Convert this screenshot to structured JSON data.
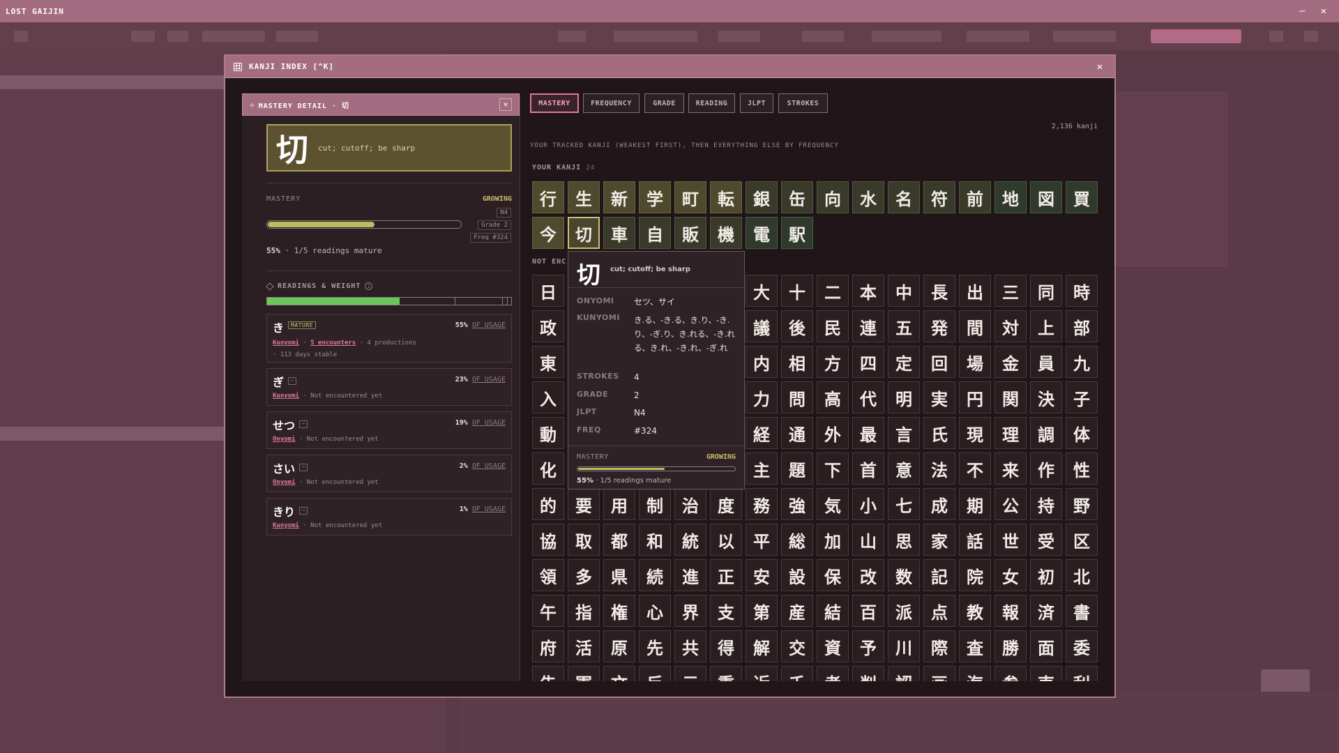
{
  "os": {
    "title": "LOST GAIJIN",
    "minimize": "—",
    "close": "✕"
  },
  "modal": {
    "title": "KANJI INDEX [^K]",
    "close": "✕"
  },
  "detail": {
    "title": "MASTERY DETAIL · 切",
    "close": "✕",
    "kanji": "切",
    "gloss": "cut; cutoff; be sharp",
    "mastery_label": "MASTERY",
    "mastery_value": "GROWING",
    "badges": [
      "N4",
      "Grade 2",
      "Freq #324"
    ],
    "progress": 0.55,
    "pct_text": "55%",
    "pct_rest": " · 1/5 readings mature",
    "readings_label": "READINGS & WEIGHT",
    "readings": [
      {
        "kana": "き",
        "tag": "MATURE",
        "pct": "55%",
        "of": "OF USAGE",
        "type": "Kunyomi",
        "encounters": "5 encounters",
        "productions": " · 4 productions",
        "stable": "· 113 days stable"
      },
      {
        "kana": "ぎ",
        "tag": "–",
        "pct": "23%",
        "of": "OF USAGE",
        "type": "Kunyomi",
        "note": " · Not encountered yet"
      },
      {
        "kana": "せつ",
        "tag": "–",
        "pct": "19%",
        "of": "OF USAGE",
        "type": "Onyomi",
        "note": " · Not encountered yet"
      },
      {
        "kana": "さい",
        "tag": "–",
        "pct": "2%",
        "of": "OF USAGE",
        "type": "Onyomi",
        "note": " · Not encountered yet"
      },
      {
        "kana": "きり",
        "tag": "–",
        "pct": "1%",
        "of": "OF USAGE",
        "type": "Kunyomi",
        "note": " · Not encountered yet"
      }
    ]
  },
  "tabs": [
    "MASTERY",
    "FREQUENCY",
    "GRADE",
    "READING",
    "JLPT",
    "STROKES"
  ],
  "count": "2,136 kanji",
  "hint": "YOUR TRACKED KANJI (WEAKEST FIRST), THEN EVERYTHING ELSE BY FREQUENCY",
  "your_label": "YOUR KANJI",
  "your_count": "24",
  "nenc_label": "NOT ENC",
  "your_kanji": [
    "行",
    "生",
    "新",
    "学",
    "町",
    "転",
    "銀",
    "缶",
    "向",
    "水",
    "名",
    "符",
    "前",
    "地",
    "図",
    "買",
    "今",
    "切",
    "車",
    "自",
    "販",
    "機",
    "電",
    "駅"
  ],
  "grid_rows": [
    [
      "日",
      "",
      "",
      "",
      "",
      "",
      "大",
      "十",
      "二",
      "本",
      "中",
      "長",
      "出",
      "三",
      "同",
      "時"
    ],
    [
      "政",
      "",
      "",
      "",
      "",
      "",
      "議",
      "後",
      "民",
      "連",
      "五",
      "発",
      "間",
      "対",
      "上",
      "部"
    ],
    [
      "東",
      "",
      "",
      "",
      "",
      "",
      "内",
      "相",
      "方",
      "四",
      "定",
      "回",
      "場",
      "金",
      "員",
      "九"
    ],
    [
      "入",
      "",
      "",
      "",
      "",
      "",
      "力",
      "問",
      "高",
      "代",
      "明",
      "実",
      "円",
      "関",
      "決",
      "子"
    ],
    [
      "動",
      "",
      "",
      "",
      "",
      "",
      "経",
      "通",
      "外",
      "最",
      "言",
      "氏",
      "現",
      "理",
      "調",
      "体"
    ],
    [
      "化",
      "",
      "",
      "",
      "",
      "",
      "主",
      "題",
      "下",
      "首",
      "意",
      "法",
      "不",
      "来",
      "作",
      "性"
    ],
    [
      "的",
      "要",
      "用",
      "制",
      "治",
      "度",
      "務",
      "強",
      "気",
      "小",
      "七",
      "成",
      "期",
      "公",
      "持",
      "野"
    ],
    [
      "協",
      "取",
      "都",
      "和",
      "統",
      "以",
      "平",
      "総",
      "加",
      "山",
      "思",
      "家",
      "話",
      "世",
      "受",
      "区"
    ],
    [
      "領",
      "多",
      "県",
      "続",
      "進",
      "正",
      "安",
      "設",
      "保",
      "改",
      "数",
      "記",
      "院",
      "女",
      "初",
      "北"
    ],
    [
      "午",
      "指",
      "権",
      "心",
      "界",
      "支",
      "第",
      "産",
      "結",
      "百",
      "派",
      "点",
      "教",
      "報",
      "済",
      "書"
    ],
    [
      "府",
      "活",
      "原",
      "先",
      "共",
      "得",
      "解",
      "交",
      "資",
      "予",
      "川",
      "際",
      "査",
      "勝",
      "面",
      "委"
    ],
    [
      "告",
      "軍",
      "文",
      "反",
      "元",
      "重",
      "近",
      "千",
      "考",
      "判",
      "認",
      "画",
      "海",
      "参",
      "売",
      "利"
    ]
  ],
  "tooltip": {
    "kanji": "切",
    "gloss": "cut; cutoff; be sharp",
    "onyomi_key": "ONYOMI",
    "onyomi": "セツ、サイ",
    "kunyomi_key": "KUNYOMI",
    "kunyomi": "き.る、-き.る、き.り、-き.り、-ぎ.り、き.れる、-き.れる、き.れ、-き.れ、-ぎ.れ",
    "strokes_key": "STROKES",
    "strokes": "4",
    "grade_key": "GRADE",
    "grade": "2",
    "jlpt_key": "JLPT",
    "jlpt": "N4",
    "freq_key": "FREQ",
    "freq": "#324",
    "mastery_key": "MASTERY",
    "mastery": "GROWING",
    "pct": "55%",
    "pct_rest": " · 1/5 readings mature",
    "progress": 0.55
  },
  "colors": {
    "accent": "#e07aa0",
    "growing": "#c9bd65",
    "bar": "#b9bf5f",
    "weight": "#6bc75a"
  }
}
